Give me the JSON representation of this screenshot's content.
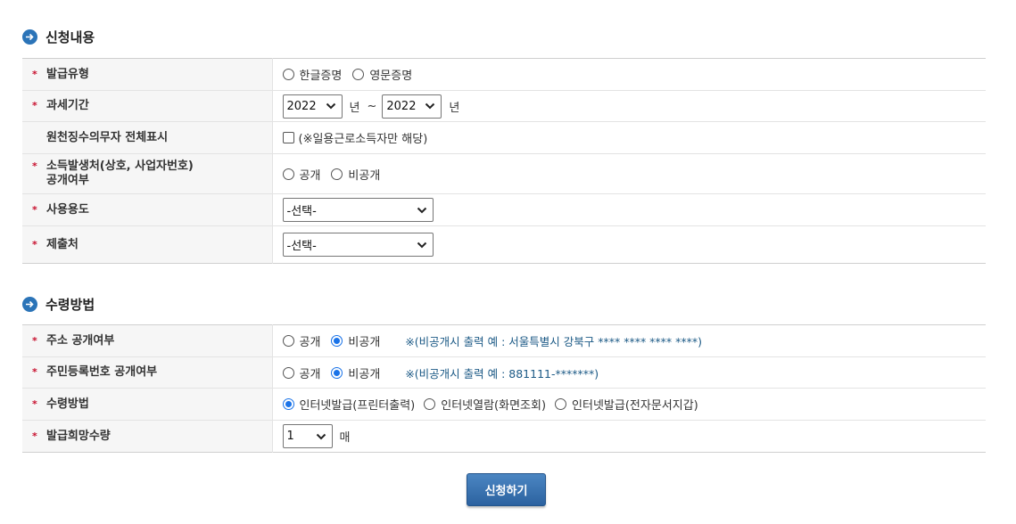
{
  "section1": {
    "title": "신청내용",
    "rows": {
      "issue_type": {
        "label": "발급유형",
        "options": [
          "한글증명",
          "영문증명"
        ]
      },
      "tax_period": {
        "label": "과세기간",
        "from_year": "2022",
        "to_year": "2022",
        "unit": "년",
        "separator": "~"
      },
      "withholding": {
        "label": "원천징수의무자 전체표시",
        "checkbox_text": "(※일용근로소득자만 해당)"
      },
      "income_source": {
        "label_line1": "소득발생처(상호, 사업자번호)",
        "label_line2": "공개여부",
        "options": [
          "공개",
          "비공개"
        ]
      },
      "purpose": {
        "label": "사용용도",
        "selected": "-선택-"
      },
      "submit_to": {
        "label": "제출처",
        "selected": "-선택-"
      }
    }
  },
  "section2": {
    "title": "수령방법",
    "rows": {
      "address": {
        "label": "주소 공개여부",
        "options": [
          "공개",
          "비공개"
        ],
        "selected": "비공개",
        "note": "※(비공개시 출력 예 : 서울특별시 강북구 **** **** **** ****)"
      },
      "rrn": {
        "label": "주민등록번호 공개여부",
        "options": [
          "공개",
          "비공개"
        ],
        "selected": "비공개",
        "note": "※(비공개시 출력 예 : 881111-*******)"
      },
      "method": {
        "label": "수령방법",
        "options": [
          "인터넷발급(프린터출력)",
          "인터넷열람(화면조회)",
          "인터넷발급(전자문서지갑)"
        ],
        "selected": "인터넷발급(프린터출력)"
      },
      "quantity": {
        "label": "발급희망수량",
        "value": "1",
        "unit": "매"
      }
    }
  },
  "submit_label": "신청하기",
  "required_mark": "*",
  "colors": {
    "accent": "#2b74b8",
    "required": "#c8102e",
    "note": "#1c5a86",
    "button": "#2c62a0"
  }
}
